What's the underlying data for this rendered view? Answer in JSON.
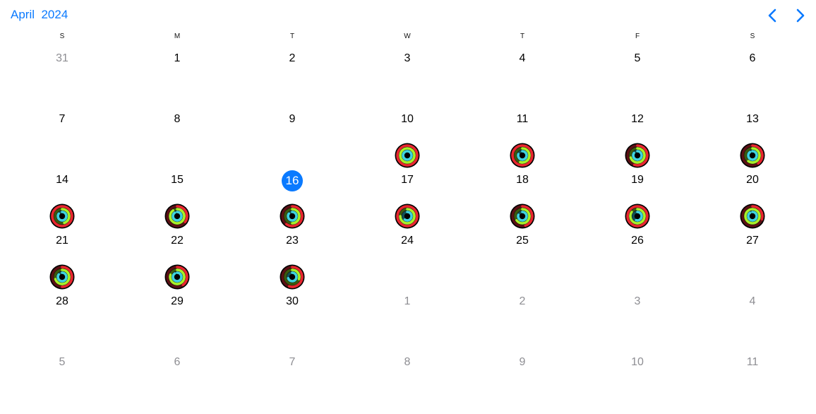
{
  "header": {
    "month": "April",
    "year": "2024",
    "prev_icon": "chevron-left-icon",
    "next_icon": "chevron-right-icon"
  },
  "colors": {
    "accent": "#0a7aff",
    "move_ring": "#e8262f",
    "exercise_ring": "#a8f02a",
    "stand_ring": "#3fd3e0",
    "muted_text": "#8e8e93"
  },
  "weekdays": [
    "S",
    "M",
    "T",
    "W",
    "T",
    "F",
    "S"
  ],
  "weeks": [
    [
      {
        "day": "31",
        "muted": true
      },
      {
        "day": "1"
      },
      {
        "day": "2"
      },
      {
        "day": "3"
      },
      {
        "day": "4"
      },
      {
        "day": "5"
      },
      {
        "day": "6"
      }
    ],
    [
      {
        "day": "7"
      },
      {
        "day": "8"
      },
      {
        "day": "9"
      },
      {
        "day": "10",
        "rings": {
          "move": 1.0,
          "exercise": 1.0,
          "stand": 1.0
        }
      },
      {
        "day": "11",
        "rings": {
          "move": 1.0,
          "exercise": 0.55,
          "stand": 0.8
        }
      },
      {
        "day": "12",
        "rings": {
          "move": 0.55,
          "exercise": 0.7,
          "stand": 0.85
        }
      },
      {
        "day": "13",
        "rings": {
          "move": 0.4,
          "exercise": 0.6,
          "stand": 0.9
        }
      }
    ],
    [
      {
        "day": "14",
        "rings": {
          "move": 1.0,
          "exercise": 0.45,
          "stand": 0.85
        }
      },
      {
        "day": "15",
        "rings": {
          "move": 0.35,
          "exercise": 0.9,
          "stand": 0.9
        }
      },
      {
        "day": "16",
        "today": true,
        "rings": {
          "move": 0.6,
          "exercise": 0.5,
          "stand": 0.85
        }
      },
      {
        "day": "17",
        "rings": {
          "move": 1.0,
          "exercise": 0.75,
          "stand": 0.6
        }
      },
      {
        "day": "18",
        "rings": {
          "move": 0.45,
          "exercise": 0.65,
          "stand": 0.8
        }
      },
      {
        "day": "19",
        "rings": {
          "move": 1.0,
          "exercise": 0.85,
          "stand": 0.55
        }
      },
      {
        "day": "20",
        "rings": {
          "move": 0.3,
          "exercise": 1.0,
          "stand": 0.9
        }
      }
    ],
    [
      {
        "day": "21",
        "rings": {
          "move": 0.5,
          "exercise": 0.7,
          "stand": 0.85
        }
      },
      {
        "day": "22",
        "rings": {
          "move": 0.4,
          "exercise": 0.8,
          "stand": 0.9
        }
      },
      {
        "day": "23",
        "rings": {
          "move": 0.55,
          "exercise": 0.3,
          "stand": 0.7
        }
      },
      {
        "day": "24"
      },
      {
        "day": "25"
      },
      {
        "day": "26"
      },
      {
        "day": "27"
      }
    ],
    [
      {
        "day": "28"
      },
      {
        "day": "29"
      },
      {
        "day": "30"
      },
      {
        "day": "1",
        "muted": true
      },
      {
        "day": "2",
        "muted": true
      },
      {
        "day": "3",
        "muted": true
      },
      {
        "day": "4",
        "muted": true
      }
    ],
    [
      {
        "day": "5",
        "muted": true
      },
      {
        "day": "6",
        "muted": true
      },
      {
        "day": "7",
        "muted": true
      },
      {
        "day": "8",
        "muted": true
      },
      {
        "day": "9",
        "muted": true
      },
      {
        "day": "10",
        "muted": true
      },
      {
        "day": "11",
        "muted": true
      }
    ]
  ]
}
